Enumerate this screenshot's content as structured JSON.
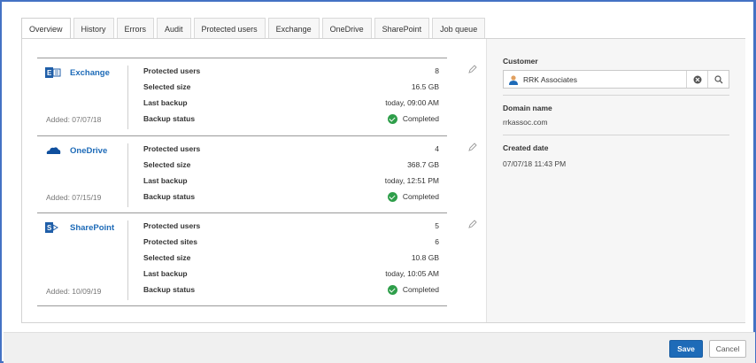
{
  "tabs": [
    {
      "label": "Overview",
      "active": true
    },
    {
      "label": "History"
    },
    {
      "label": "Errors"
    },
    {
      "label": "Audit"
    },
    {
      "label": "Protected users"
    },
    {
      "label": "Exchange"
    },
    {
      "label": "OneDrive"
    },
    {
      "label": "SharePoint"
    },
    {
      "label": "Job queue"
    }
  ],
  "services": [
    {
      "name": "Exchange",
      "icon": "exchange-icon",
      "added": "Added: 07/07/18",
      "rows": [
        {
          "key": "Protected users",
          "value": "8"
        },
        {
          "key": "Selected size",
          "value": "16.5 GB"
        },
        {
          "key": "Last backup",
          "value": "today, 09:00 AM"
        },
        {
          "key": "Backup status",
          "value": "Completed",
          "status": true
        }
      ]
    },
    {
      "name": "OneDrive",
      "icon": "onedrive-icon",
      "added": "Added: 07/15/19",
      "rows": [
        {
          "key": "Protected users",
          "value": "4"
        },
        {
          "key": "Selected size",
          "value": "368.7 GB"
        },
        {
          "key": "Last backup",
          "value": "today, 12:51 PM"
        },
        {
          "key": "Backup status",
          "value": "Completed",
          "status": true
        }
      ]
    },
    {
      "name": "SharePoint",
      "icon": "sharepoint-icon",
      "added": "Added: 10/09/19",
      "rows": [
        {
          "key": "Protected users",
          "value": "5"
        },
        {
          "key": "Protected sites",
          "value": "6"
        },
        {
          "key": "Selected size",
          "value": "10.8 GB"
        },
        {
          "key": "Last backup",
          "value": "today, 10:05 AM"
        },
        {
          "key": "Backup status",
          "value": "Completed",
          "status": true
        }
      ]
    }
  ],
  "details": {
    "customer_label": "Customer",
    "customer_value": "RRK Associates",
    "domain_label": "Domain name",
    "domain_value": "rrkassoc.com",
    "created_label": "Created date",
    "created_value": "07/07/18 11:43 PM"
  },
  "footer": {
    "save_label": "Save",
    "cancel_label": "Cancel"
  },
  "colors": {
    "accent": "#1e6bb8",
    "frame": "#4472c4",
    "status_ok": "#2e9e4a"
  }
}
